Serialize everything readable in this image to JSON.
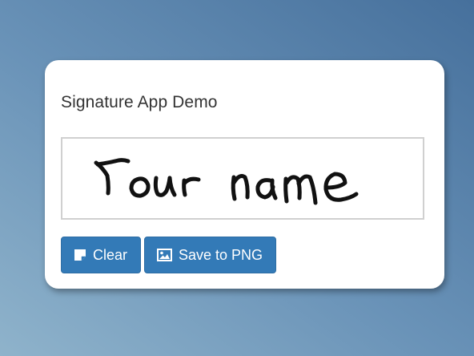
{
  "app": {
    "title": "Signature App Demo"
  },
  "signature_pad": {
    "drawn_text": "Your name"
  },
  "buttons": {
    "clear_label": "Clear",
    "clear_icon": "note-icon",
    "save_label": "Save to PNG",
    "save_icon": "image-icon"
  },
  "colors": {
    "accent": "#337ab7",
    "ink": "#111111"
  }
}
